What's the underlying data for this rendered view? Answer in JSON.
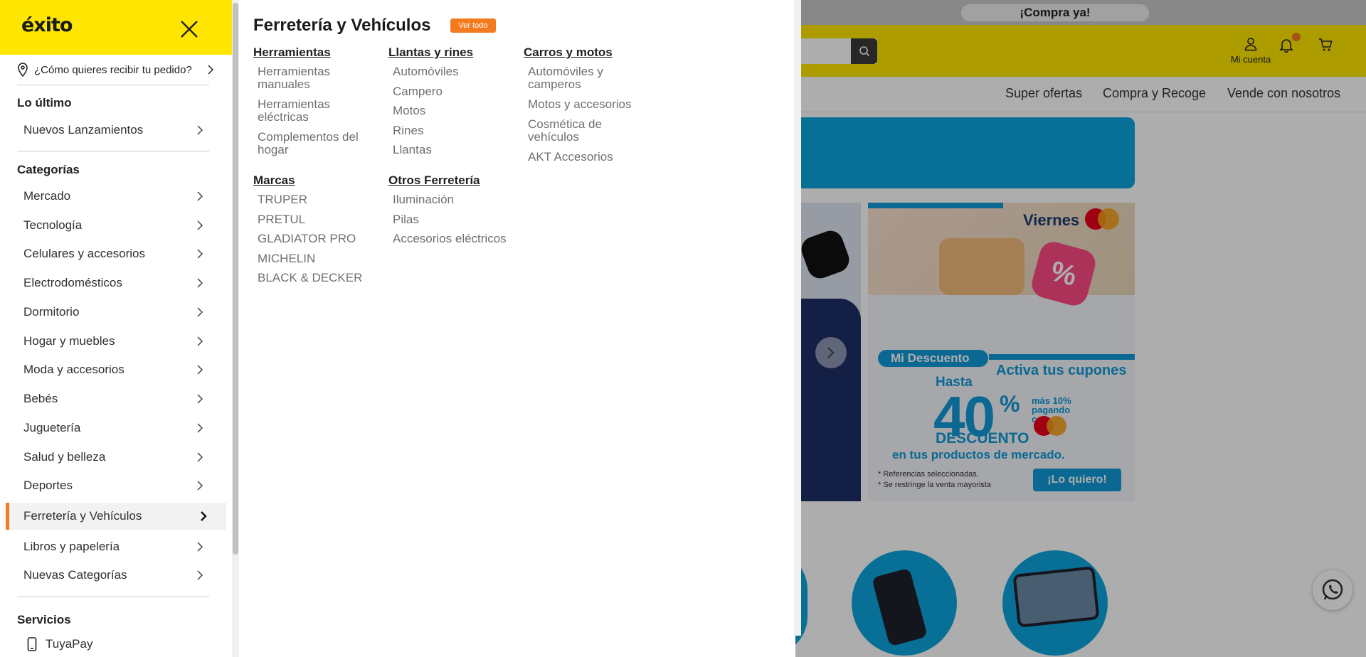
{
  "background": {
    "promo_pill": "¡Compra ya!",
    "account_label": "Mi cuenta",
    "nav_links": [
      "Super ofertas",
      "Compra y Recoge",
      "Vende con nosotros"
    ],
    "promo_card": {
      "brand_day": "Viernes",
      "badge": "Mi Descuento",
      "headline": "Activa tus cupones",
      "hasta": "Hasta",
      "big_value": "40",
      "percent": "%",
      "extra": "más 10% pagando con",
      "descuento": "DESCUENTO",
      "scope": "en tus productos de mercado.",
      "fine_print_1": "* Referencias seleccionadas.",
      "fine_print_2": "* Se restringe la venta mayorista",
      "cta": "¡Lo quiero!"
    }
  },
  "drawer": {
    "logo": "éxito",
    "deliver_prompt": "¿Cómo quieres recibir tu pedido?",
    "section_latest": "Lo último",
    "latest_items": [
      "Nuevos Lanzamientos"
    ],
    "section_categories": "Categorías",
    "categories": [
      "Mercado",
      "Tecnología",
      "Celulares y accesorios",
      "Electrodomésticos",
      "Dormitorio",
      "Hogar y muebles",
      "Moda y accesorios",
      "Bebés",
      "Juguetería",
      "Salud y belleza",
      "Deportes",
      "Ferretería y Vehículos",
      "Libros y papelería",
      "Nuevas Categorías"
    ],
    "active_category": "Ferretería y Vehículos",
    "section_services": "Servicios",
    "services": [
      "TuyaPay"
    ]
  },
  "submenu": {
    "title": "Ferretería y Vehículos",
    "see_all": "Ver todo",
    "columns": [
      {
        "groups": [
          {
            "heading": "Herramientas",
            "links": [
              "Herramientas manuales",
              "Herramientas eléctricas",
              "Complementos del hogar"
            ]
          },
          {
            "heading": "Marcas",
            "links": [
              "TRUPER",
              "PRETUL",
              "GLADIATOR PRO",
              "MICHELIN",
              "BLACK & DECKER"
            ]
          }
        ]
      },
      {
        "groups": [
          {
            "heading": "Llantas y rines",
            "links": [
              "Automóviles",
              "Campero",
              "Motos",
              "Rines",
              "Llantas"
            ]
          },
          {
            "heading": "Otros Ferretería",
            "links": [
              "Iluminación",
              "Pilas",
              "Accesorios eléctricos"
            ]
          }
        ]
      },
      {
        "groups": [
          {
            "heading": "Carros y motos",
            "links": [
              "Automóviles y camperos",
              "Motos y accesorios",
              "Cosmética de vehículos",
              "AKT Accesorios"
            ]
          }
        ]
      }
    ]
  },
  "colors": {
    "brand_yellow": "#ffe600",
    "accent_orange": "#f47a20",
    "promo_blue": "#0f9ad8"
  },
  "icons": {
    "close": "close-icon",
    "location": "location-pin-icon",
    "chevron": "chevron-right-icon",
    "search": "search-icon",
    "account": "user-icon",
    "bell": "bell-icon",
    "cart": "cart-icon",
    "phone": "phone-icon",
    "whatsapp": "whatsapp-icon"
  }
}
